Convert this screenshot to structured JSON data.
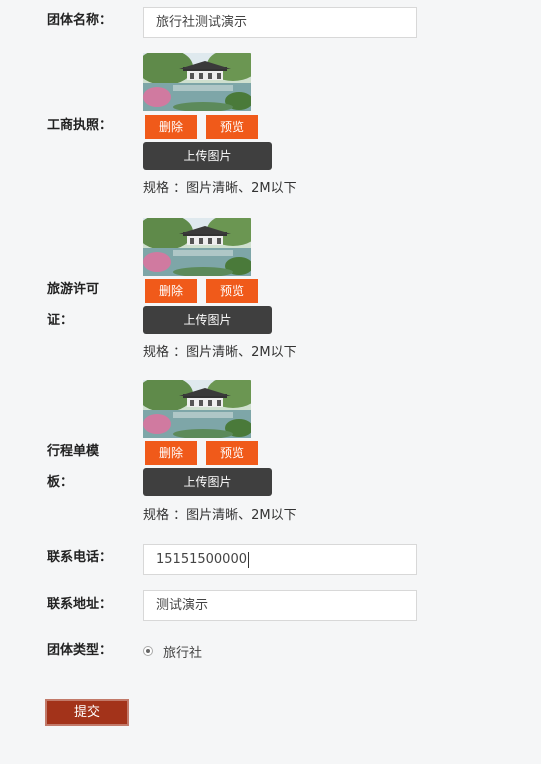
{
  "fields": {
    "group_name": {
      "label": "团体名称：",
      "value": "旅行社测试演示"
    },
    "business_license": {
      "label": "工商执照："
    },
    "travel_permit": {
      "label_line1": "旅游许可",
      "label_line2": "证："
    },
    "itinerary_template": {
      "label_line1": "行程单模",
      "label_line2": "板："
    },
    "contact_phone": {
      "label": "联系电话：",
      "value": "15151500000"
    },
    "contact_address": {
      "label": "联系地址：",
      "value": "测试演示"
    },
    "group_type": {
      "label": "团体类型：",
      "option": "旅行社"
    }
  },
  "image_upload": {
    "delete_label": "删除",
    "preview_label": "预览",
    "upload_label": "上传图片",
    "spec_text": "规格 ：图片清晰、2M以下"
  },
  "submit_label": "提交",
  "colors": {
    "accent_red": "#f05a1a",
    "upload_dark": "#3f3f3f",
    "submit_brown": "#a3331a"
  }
}
